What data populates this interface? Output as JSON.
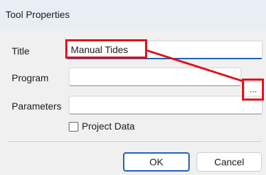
{
  "window": {
    "title": "Tool Properties"
  },
  "form": {
    "title_label": "Title",
    "title_value": "Manual Tides",
    "program_label": "Program",
    "program_value": "",
    "browse_label": "...",
    "parameters_label": "Parameters",
    "parameters_value": "",
    "project_data_label": "Project Data",
    "project_data_checked": false
  },
  "buttons": {
    "ok": "OK",
    "cancel": "Cancel"
  },
  "annotation": {
    "color": "#e0101a"
  }
}
